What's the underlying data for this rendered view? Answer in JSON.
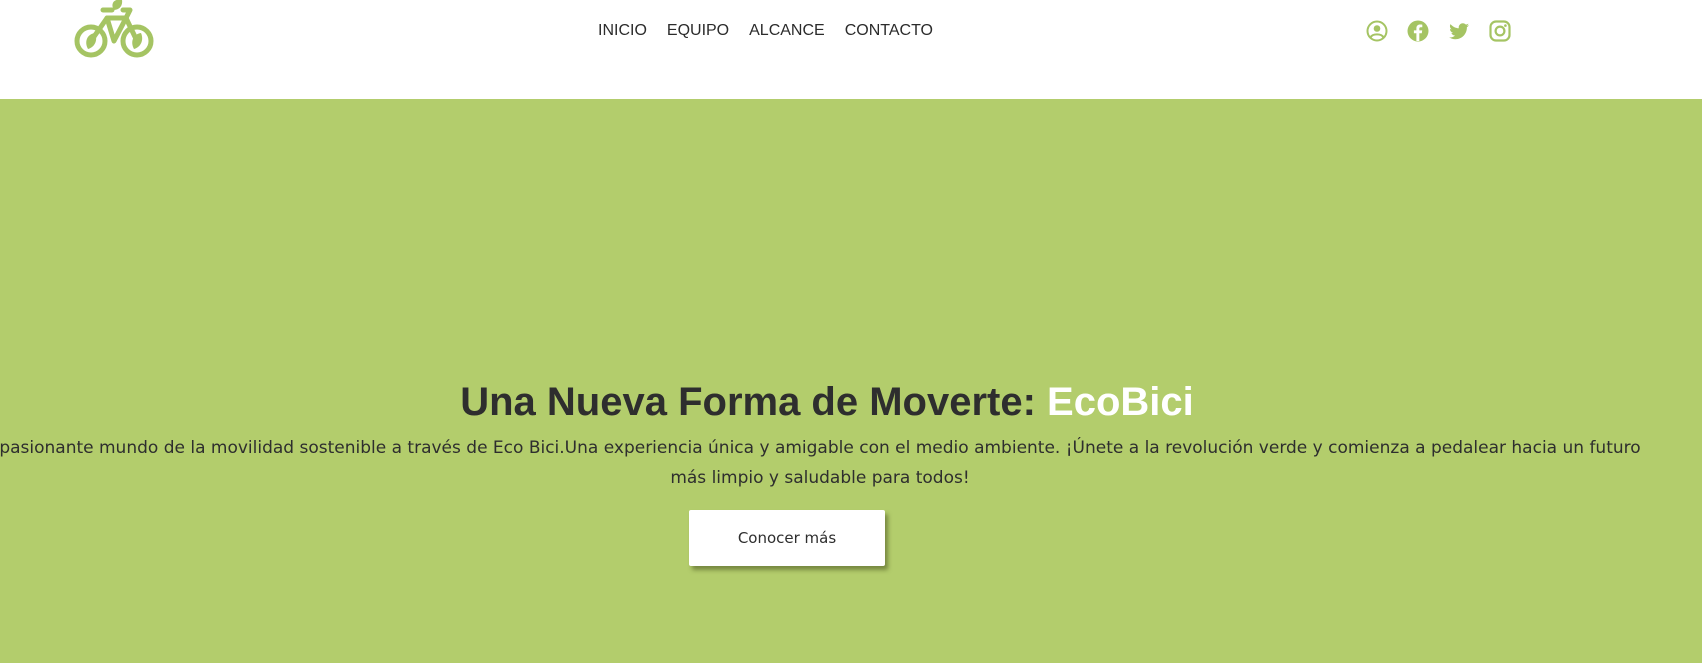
{
  "colors": {
    "brand_green": "#b3cd6c",
    "icon_green": "#a5c463",
    "text_dark": "#2e2e2e",
    "accent_white": "#ffffff"
  },
  "header": {
    "logo_icon": "bicycle-leaf-logo",
    "nav": [
      {
        "label": "INICIO"
      },
      {
        "label": "EQUIPO"
      },
      {
        "label": "ALCANCE"
      },
      {
        "label": "CONTACTO"
      }
    ],
    "social_icons": [
      "user-icon",
      "facebook-icon",
      "twitter-icon",
      "instagram-icon"
    ]
  },
  "hero": {
    "title_prefix": "Una Nueva Forma de Moverte: ",
    "title_brand": "EcoBici",
    "text_line1": "pasionante mundo de la movilidad sostenible a través de Eco Bici.Una experiencia única y amigable con el medio ambiente. ¡Únete a la revolución verde y comienza a pedalear hacia un futuro",
    "text_line2": "más limpio y saludable para todos!",
    "cta_label": "Conocer más"
  }
}
